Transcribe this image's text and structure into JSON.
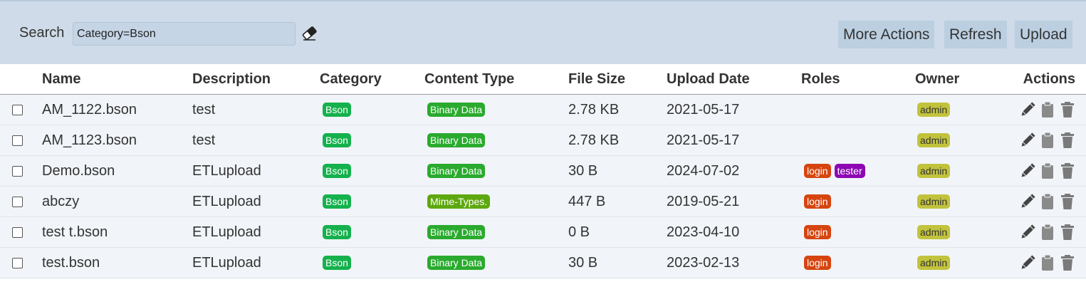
{
  "toolbar": {
    "search_label": "Search",
    "search_value": "Category=Bson",
    "more_actions_label": "More Actions",
    "refresh_label": "Refresh",
    "upload_label": "Upload"
  },
  "table": {
    "headers": {
      "name": "Name",
      "description": "Description",
      "category": "Category",
      "content_type": "Content Type",
      "file_size": "File Size",
      "upload_date": "Upload Date",
      "roles": "Roles",
      "owner": "Owner",
      "actions": "Actions"
    },
    "rows": [
      {
        "name": "AM_1122.bson",
        "description": "test",
        "category": "Bson",
        "content_type": "Binary Data",
        "content_type_color": "#2aaa2e",
        "file_size": "2.78 KB",
        "upload_date": "2021-05-17",
        "roles": [],
        "owner": "admin"
      },
      {
        "name": "AM_1123.bson",
        "description": "test",
        "category": "Bson",
        "content_type": "Binary Data",
        "content_type_color": "#2aaa2e",
        "file_size": "2.78 KB",
        "upload_date": "2021-05-17",
        "roles": [],
        "owner": "admin"
      },
      {
        "name": "Demo.bson",
        "description": "ETLupload",
        "category": "Bson",
        "content_type": "Binary Data",
        "content_type_color": "#2aaa2e",
        "file_size": "30 B",
        "upload_date": "2024-07-02",
        "roles": [
          "login",
          "tester"
        ],
        "owner": "admin"
      },
      {
        "name": "abczy",
        "description": "ETLupload",
        "category": "Bson",
        "content_type": "Mime-Types.",
        "content_type_color": "#5ea80f",
        "file_size": "447 B",
        "upload_date": "2019-05-21",
        "roles": [
          "login"
        ],
        "owner": "admin"
      },
      {
        "name": "test t.bson",
        "description": "ETLupload",
        "category": "Bson",
        "content_type": "Binary Data",
        "content_type_color": "#2aaa2e",
        "file_size": "0 B",
        "upload_date": "2023-04-10",
        "roles": [
          "login"
        ],
        "owner": "admin"
      },
      {
        "name": "test.bson",
        "description": "ETLupload",
        "category": "Bson",
        "content_type": "Binary Data",
        "content_type_color": "#2aaa2e",
        "file_size": "30 B",
        "upload_date": "2023-02-13",
        "roles": [
          "login"
        ],
        "owner": "admin"
      }
    ]
  },
  "colors": {
    "toolbar_bg": "#cfdbe8",
    "category_badge": "#14b14c",
    "binary_data_badge": "#2aaa2e",
    "mime_badge": "#5ea80f",
    "login_badge": "#d64510",
    "tester_badge": "#8d08b4",
    "owner_badge": "#c2c33d"
  },
  "icons": {
    "eraser": "eraser-icon",
    "edit": "pencil-icon",
    "copy": "clipboard-icon",
    "delete": "trash-icon"
  }
}
